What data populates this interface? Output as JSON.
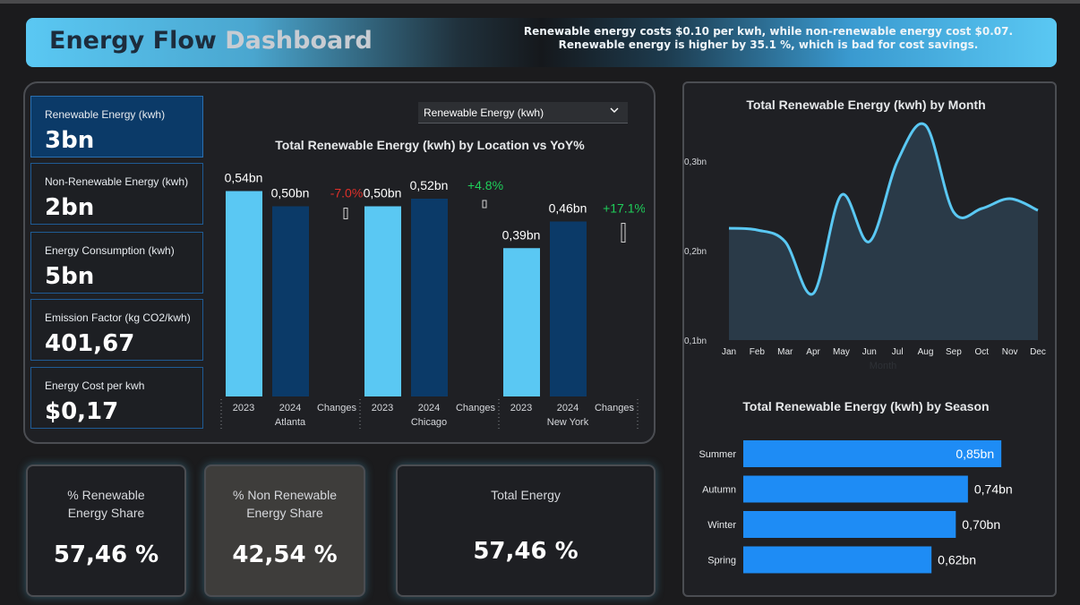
{
  "header": {
    "title_part1": "Energy Flow",
    "title_part2": "Dashboard",
    "note_line1": "Renewable energy costs $0.10 per kwh, while non-renewable energy cost $0.07.",
    "note_line2": "Renewable energy is higher by 35.1 %, which is bad for cost savings."
  },
  "kpis": [
    {
      "label": "Renewable Energy (kwh)",
      "value": "3bn",
      "active": true
    },
    {
      "label": "Non-Renewable Energy (kwh)",
      "value": "2bn",
      "active": false
    },
    {
      "label": "Energy Consumption (kwh)",
      "value": "5bn",
      "active": false
    },
    {
      "label": "Emission Factor (kg CO2/kwh)",
      "value": "401,67",
      "active": false
    },
    {
      "label": "Energy Cost per kwh",
      "value": "$0,17",
      "active": false
    }
  ],
  "dropdown": {
    "selected": "Renewable Energy (kwh)"
  },
  "bottom_cards": [
    {
      "label_line1": "% Renewable",
      "label_line2": "Energy Share",
      "value": "57,46 %"
    },
    {
      "label_line1": "% Non Renewable",
      "label_line2": "Energy Share",
      "value": "42,54 %"
    },
    {
      "label_line1": "Total Energy",
      "label_line2": "",
      "value": "57,46 %"
    }
  ],
  "colors": {
    "bar_2023": "#5ac8f3",
    "bar_2024": "#0b3a68",
    "positive": "#1fcf5a",
    "negative": "#e0302a",
    "line": "#5ac8f3",
    "area": "#2a3a48",
    "season_bar": "#1e8cf5"
  },
  "chart_data": [
    {
      "type": "bar",
      "title": "Total Renewable Energy (kwh) by Location vs YoY%",
      "groups": [
        {
          "location": "Atlanta",
          "v2023": 0.54,
          "v2024": 0.5,
          "label2023": "0,54bn",
          "label2024": "0,50bn",
          "change": "-7.0%",
          "change_sign": "negative"
        },
        {
          "location": "Chicago",
          "v2023": 0.5,
          "v2024": 0.52,
          "label2023": "0,50bn",
          "label2024": "0,52bn",
          "change": "+4.8%",
          "change_sign": "positive"
        },
        {
          "location": "New York",
          "v2023": 0.39,
          "v2024": 0.46,
          "label2023": "0,39bn",
          "label2024": "0,46bn",
          "change": "+17.1%",
          "change_sign": "positive"
        }
      ],
      "categories": [
        "2023",
        "2024",
        "Changes"
      ],
      "ylim": [
        0,
        0.6
      ]
    },
    {
      "type": "area",
      "title": "Total Renewable Energy (kwh) by Month",
      "xlabel": "Month",
      "x": [
        "Jan",
        "Feb",
        "Mar",
        "Apr",
        "May",
        "Jun",
        "Jul",
        "Aug",
        "Sep",
        "Oct",
        "Nov",
        "Dec"
      ],
      "values": [
        0.225,
        0.223,
        0.21,
        0.152,
        0.262,
        0.21,
        0.3,
        0.34,
        0.243,
        0.247,
        0.258,
        0.245
      ],
      "yticks": [
        "0,1bn",
        "0,2bn",
        "0,3bn"
      ],
      "ylim": [
        0.1,
        0.3
      ]
    },
    {
      "type": "bar",
      "orientation": "horizontal",
      "title": "Total Renewable Energy (kwh) by Season",
      "categories": [
        "Summer",
        "Autumn",
        "Winter",
        "Spring"
      ],
      "values": [
        0.85,
        0.74,
        0.7,
        0.62
      ],
      "labels": [
        "0,85bn",
        "0,74bn",
        "0,70bn",
        "0,62bn"
      ]
    }
  ]
}
